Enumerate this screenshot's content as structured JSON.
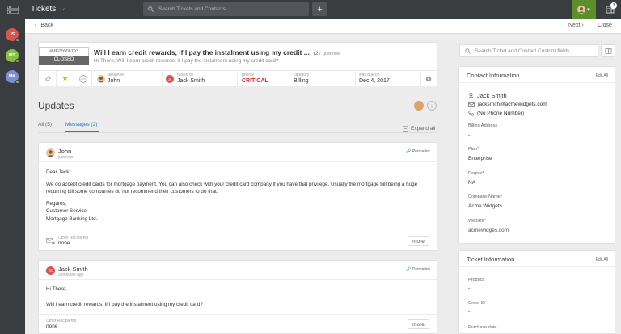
{
  "topbar": {
    "module_title": "Tickets",
    "search_placeholder": "Search Tickets and Contacts",
    "add_label": "+",
    "notification_count": "3"
  },
  "rail": {
    "avatars": [
      {
        "initials": "JS",
        "color": "#d9534f"
      },
      {
        "initials": "MS",
        "color": "#8bbf3f"
      },
      {
        "initials": "MK",
        "color": "#7b8fd1"
      }
    ]
  },
  "subbar": {
    "back_label": "Back",
    "next_label": "Next",
    "close_label": "Close"
  },
  "ticket": {
    "id": "#ME00006793",
    "status": "CLOSED",
    "subject": "Will I earn credit rewards, if I pay the instalment using my credit ...",
    "thread_count": "(2)",
    "time": "just now",
    "preview": "Hi There, Will I earn credit rewards, if I pay the instalment using my credit card?",
    "props": {
      "assignee_label": "assignee",
      "assignee": "John",
      "raised_label": "raised by",
      "raised_by": "Jack Smith",
      "priority_label": "priority",
      "priority": "CRITICAL",
      "category_label": "category",
      "category": "Billing",
      "due_label": "was due on",
      "due": "Dec 4, 2017"
    }
  },
  "updates": {
    "title": "Updates",
    "tab_all": "All (5)",
    "tab_messages": "Messages (2)",
    "expand_all": "Expand all"
  },
  "messages": [
    {
      "author": "John",
      "time": "just now",
      "permalink": "Permalink",
      "greeting": "Dear Jack,",
      "body": "We do accept credit cards for mortgage payment. You can also check with your credit card company if you have that privilege. Usually the mortgage bill being a huge recurring bill some companies do not recommend their customers to do that.",
      "sign_1": "Regards,",
      "sign_2": "Customer Service",
      "sign_3": "Mortgage Banking Ltd.",
      "recipients_label": "Other Recipients",
      "recipients": "none",
      "more": "more"
    },
    {
      "author": "Jack Smith",
      "time": "3 minutes ago",
      "permalink": "Permalink",
      "greeting": "Hi There,",
      "body": "Will I earn credit rewards, if I pay the instalment using my credit card?",
      "recipients_label": "Other Recipients",
      "recipients": "none",
      "more": "more"
    }
  ],
  "right_panel": {
    "search_placeholder": "Search Ticket and Contact Custom fields",
    "contact": {
      "title": "Contact Information",
      "edit_all": "Edit All",
      "name": "Jack Smith",
      "email": "jacksmith@acmewidgets.com",
      "phone": "(No Phone Number)",
      "billing_label": "Billing Address",
      "billing_value": "-",
      "plan_label": "Plan*",
      "plan_value": "Enterprise",
      "region_label": "Region*",
      "region_value": "NA",
      "company_label": "Company Name*",
      "company_value": "Acme Widgets",
      "website_label": "Website*",
      "website_value": "acmewidges.com"
    },
    "ticket_info": {
      "title": "Ticket Information",
      "edit_all": "Edit All",
      "product_label": "Product",
      "product_value": "-",
      "order_label": "Order ID",
      "order_value": "-",
      "purchase_label": "Purchase date"
    }
  },
  "colors": {
    "accent": "#1f7ec1",
    "critical": "#d9272e",
    "agent_green": "#5b8f2a",
    "topbar": "#3a3d40"
  }
}
